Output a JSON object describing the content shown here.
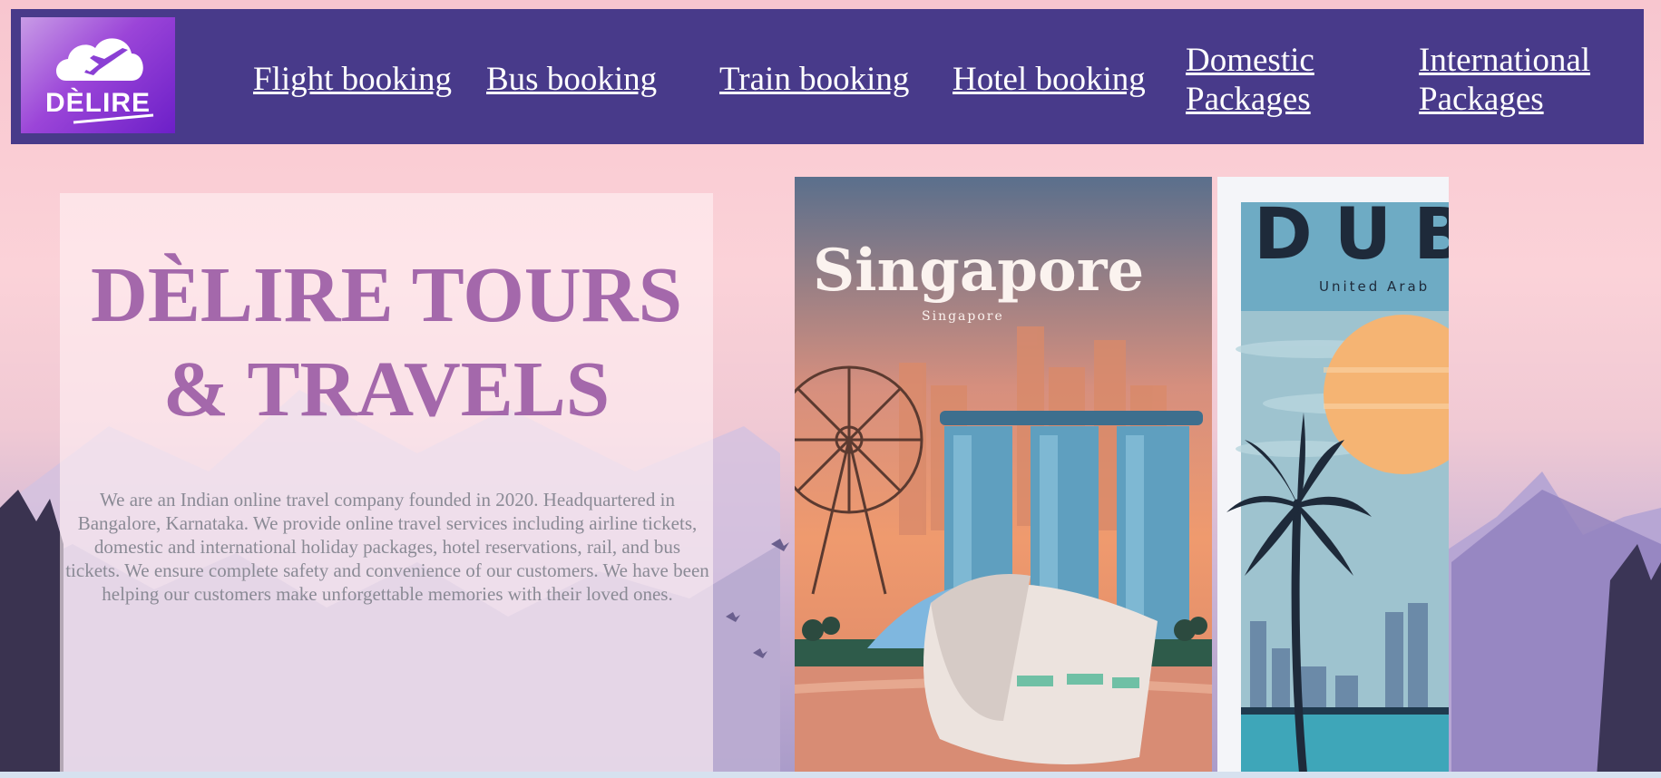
{
  "brand": {
    "logo_text": "DÈLIRE",
    "logo_icon": "cloud-plane-icon"
  },
  "nav": {
    "items": [
      {
        "label": "Flight booking"
      },
      {
        "label": "Bus booking"
      },
      {
        "label": "Train booking"
      },
      {
        "label": "Hotel booking"
      },
      {
        "label_line1": "Domestic",
        "label_line2": "Packages"
      },
      {
        "label_line1": "International",
        "label_line2": "Packages"
      }
    ]
  },
  "hero": {
    "title_line1": "DÈLIRE TOURS",
    "title_line2": "& TRAVELS",
    "description": "We are an Indian online travel company founded in 2020. Headquartered in Bangalore, Karnataka. We provide online travel services including airline tickets, domestic and international holiday packages, hotel reservations, rail, and bus tickets. We ensure complete safety and convenience of our customers. We have been helping our customers make unforgettable memories with their loved ones."
  },
  "posters": [
    {
      "title": "Singapore",
      "subtitle": "Singapore"
    },
    {
      "title": "DUB",
      "subtitle": "United Arab"
    }
  ],
  "colors": {
    "navbar": "#483a8a",
    "hero_title": "#a468ab",
    "hero_text": "#8a8a95"
  }
}
